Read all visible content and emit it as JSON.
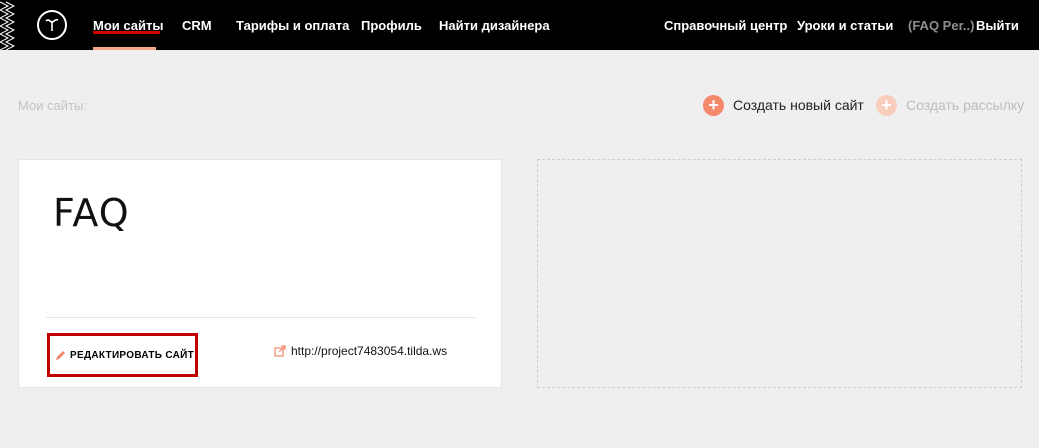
{
  "nav": {
    "left": [
      {
        "label": "Мои сайты",
        "active": true
      },
      {
        "label": "CRM"
      },
      {
        "label": "Тарифы и оплата"
      },
      {
        "label": "Профиль"
      },
      {
        "label": "Найти дизайнера"
      }
    ],
    "right": [
      {
        "label": "Справочный центр"
      },
      {
        "label": "Уроки и статьи"
      },
      {
        "label": "(FAQ Per..)"
      },
      {
        "label": "Выйти"
      }
    ]
  },
  "header": {
    "page_label": "Мои сайты:",
    "create_site": "Создать новый сайт",
    "create_mailing": "Создать рассылку"
  },
  "site_card": {
    "title": "FAQ",
    "edit_label": "РЕДАКТИРОВАТЬ САЙТ",
    "url": "http://project7483054.tilda.ws"
  },
  "colors": {
    "accent": "#f4886a",
    "highlight_frame": "#c00000",
    "topbar": "#000000"
  }
}
